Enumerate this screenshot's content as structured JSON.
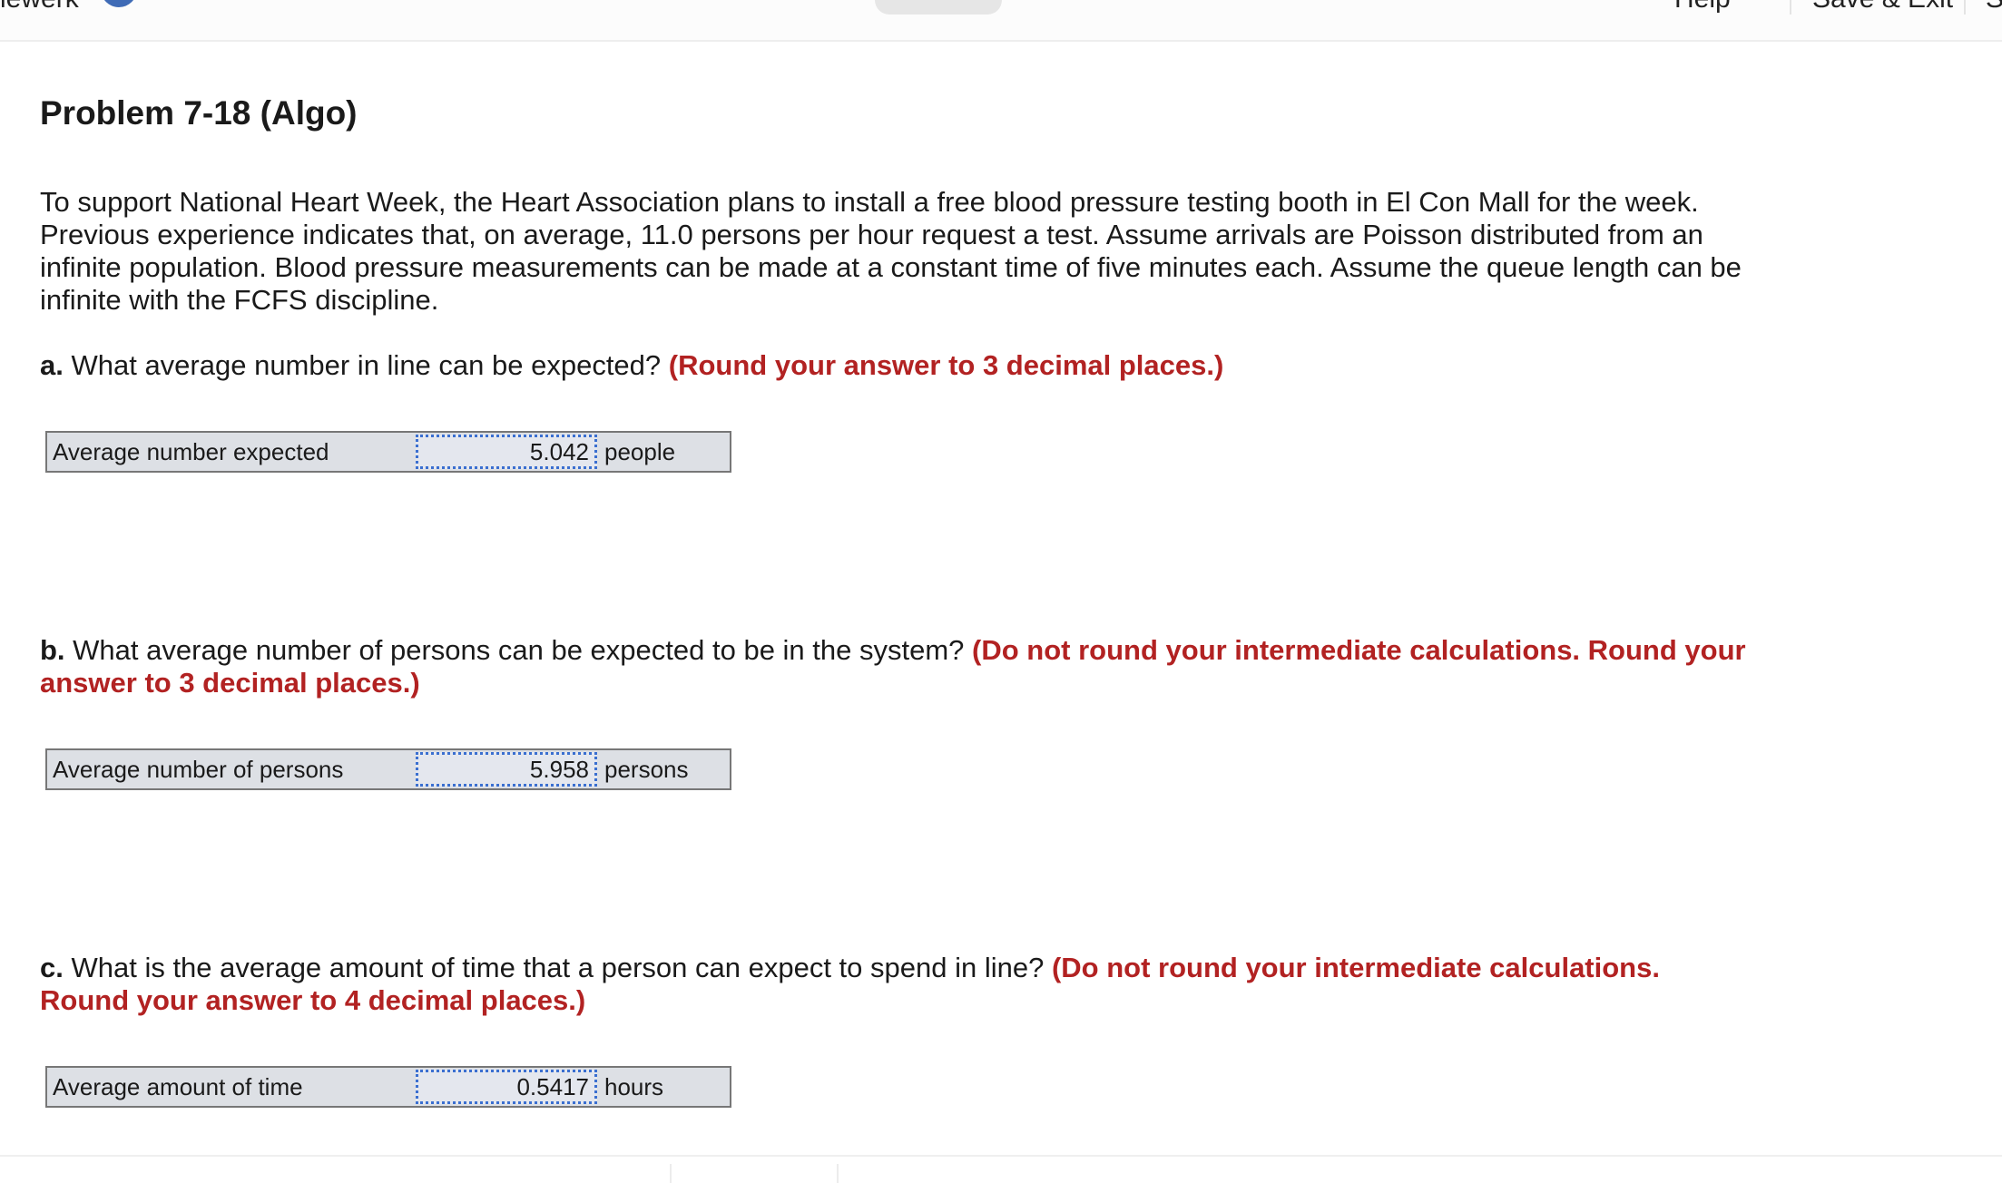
{
  "topbar": {
    "title_fragment": "iewerk",
    "right_items": [
      "Help",
      "Save & Exit",
      "S"
    ]
  },
  "problem": {
    "title": "Problem 7-18 (Algo)",
    "text": "To support National Heart Week, the Heart Association plans to install a free blood pressure testing booth in El Con Mall for the week. Previous experience indicates that, on average, 11.0 persons per hour request a test. Assume arrivals are Poisson distributed from an infinite population. Blood pressure measurements can be made at a constant time of five minutes each. Assume the queue length can be infinite with the FCFS discipline."
  },
  "questions": [
    {
      "letter": "a.",
      "text": " What average number in line can be expected? ",
      "hint": "(Round your answer to 3 decimal places.)",
      "answer_label": "Average number expected",
      "answer_value": "5.042",
      "answer_unit": "people"
    },
    {
      "letter": "b.",
      "text": " What average number of persons can be expected to be in the system? ",
      "hint": "(Do not round your intermediate calculations. Round your answer to 3 decimal places.)",
      "answer_label": "Average number of persons",
      "answer_value": "5.958",
      "answer_unit": "persons"
    },
    {
      "letter": "c.",
      "text": " What is the average amount of time that a person can expect to spend in line? ",
      "hint": "(Do not round your intermediate calculations. Round your answer to 4 decimal places.)",
      "answer_label": "Average amount of time",
      "answer_value": "0.5417",
      "answer_unit": "hours"
    }
  ]
}
